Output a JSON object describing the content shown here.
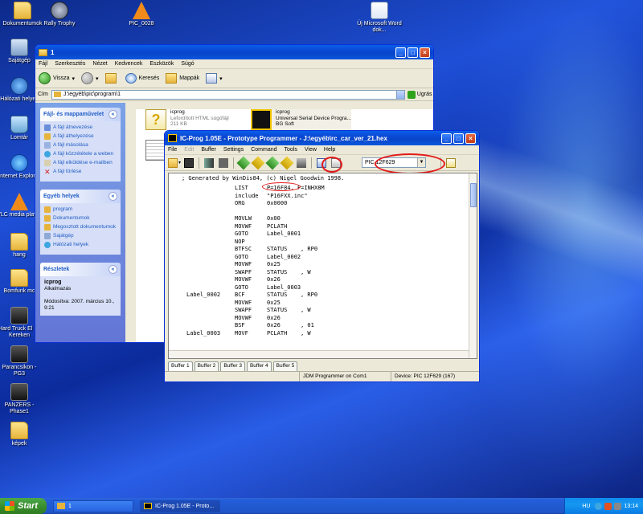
{
  "desktop": {
    "icons": [
      {
        "label": "Dokumentumok",
        "icon": "folder-icon"
      },
      {
        "label": "Rally Trophy",
        "icon": "game-icon"
      },
      {
        "label": "PIC_0028",
        "icon": "vlc-icon"
      },
      {
        "label": "Új Microsoft Word dok...",
        "icon": "word-icon"
      },
      {
        "label": "Sajátgép",
        "icon": "computer-icon"
      },
      {
        "label": "Hálózati helyek",
        "icon": "network-icon"
      },
      {
        "label": "Lomtár",
        "icon": "recycle-bin-icon"
      },
      {
        "label": "Internet Explorer",
        "icon": "internet-explorer-icon"
      },
      {
        "label": "VLC media player",
        "icon": "vlc-icon"
      },
      {
        "label": "hang",
        "icon": "folder-icon"
      },
      {
        "label": "Bomfunk mc",
        "icon": "folder-icon"
      },
      {
        "label": "Hard Truck El 18 Kereken",
        "icon": "game-icon"
      },
      {
        "label": "Parancsikon - PG3",
        "icon": "game-icon"
      },
      {
        "label": "PANZERS - Phase1",
        "icon": "game-icon"
      },
      {
        "label": "képek",
        "icon": "folder-icon"
      }
    ]
  },
  "explorer": {
    "title": "1",
    "menu": [
      "Fájl",
      "Szerkesztés",
      "Nézet",
      "Kedvencek",
      "Eszközök",
      "Súgó"
    ],
    "toolbar": {
      "back": "Vissza",
      "search": "Keresés",
      "folders": "Mappák"
    },
    "address": {
      "label": "Cím",
      "value": "J:\\egyéb\\pic\\program\\1",
      "go": "Ugrás"
    },
    "tasks_panel": {
      "title": "Fájl- és mappaművelet",
      "items": [
        "A fájl átnevezése",
        "A fájl áthelyezése",
        "A fájl másolása",
        "A fájl közzététele a weben",
        "A fájl elküldése e-mailben",
        "A fájl törlése"
      ]
    },
    "places_panel": {
      "title": "Egyéb helyek",
      "items": [
        "program",
        "Dokumentumok",
        "Megosztott dokumentumok",
        "Sajátgép",
        "Hálózati helyek"
      ]
    },
    "details_panel": {
      "title": "Részletek",
      "name": "icprog",
      "type": "Alkalmazás",
      "modified": "Módosítva: 2007. március 10., 9:21"
    },
    "files": [
      {
        "name": "icprog",
        "desc": "Lefordított HTML súgófájl",
        "size": "211 KB"
      },
      {
        "name": "icprog",
        "desc": "Universal Serial Device Progra...",
        "size": "BG Soft"
      }
    ]
  },
  "icprog": {
    "title": "IC-Prog 1.05E - Prototype Programmer - J:\\egyéb\\rc_car_ver_21.hex",
    "menu": [
      "File",
      "Edit",
      "Buffer",
      "Settings",
      "Command",
      "Tools",
      "View",
      "Help"
    ],
    "device_select": "PIC 12F629",
    "code_header": "; Generated by WinDis84, (c) Nigel Goodwin 1998.",
    "code_lines": [
      {
        "label": "",
        "op": "LIST",
        "arg": "P=16F84, F=INHX8M",
        "arg2": ""
      },
      {
        "label": "",
        "op": "include",
        "arg": "\"P16FXX.inc\"",
        "arg2": ""
      },
      {
        "label": "",
        "op": "ORG",
        "arg": "0x0000",
        "arg2": ""
      },
      {
        "label": "",
        "op": "",
        "arg": "",
        "arg2": ""
      },
      {
        "label": "",
        "op": "MOVLW",
        "arg": "0x00",
        "arg2": ""
      },
      {
        "label": "",
        "op": "MOVWF",
        "arg": "PCLATH",
        "arg2": ""
      },
      {
        "label": "",
        "op": "GOTO",
        "arg": "Label_0001",
        "arg2": ""
      },
      {
        "label": "",
        "op": "NOP",
        "arg": "",
        "arg2": ""
      },
      {
        "label": "",
        "op": "BTFSC",
        "arg": "STATUS",
        "arg2": ", RP0"
      },
      {
        "label": "",
        "op": "GOTO",
        "arg": "Label_0002",
        "arg2": ""
      },
      {
        "label": "",
        "op": "MOVWF",
        "arg": "0x25",
        "arg2": ""
      },
      {
        "label": "",
        "op": "SWAPF",
        "arg": "STATUS",
        "arg2": ", W"
      },
      {
        "label": "",
        "op": "MOVWF",
        "arg": "0x26",
        "arg2": ""
      },
      {
        "label": "",
        "op": "GOTO",
        "arg": "Label_0003",
        "arg2": ""
      },
      {
        "label": "Label_0002",
        "op": "BCF",
        "arg": "STATUS",
        "arg2": ", RP0"
      },
      {
        "label": "",
        "op": "MOVWF",
        "arg": "0x25",
        "arg2": ""
      },
      {
        "label": "",
        "op": "SWAPF",
        "arg": "STATUS",
        "arg2": ", W"
      },
      {
        "label": "",
        "op": "MOVWF",
        "arg": "0x26",
        "arg2": ""
      },
      {
        "label": "",
        "op": "BSF",
        "arg": "0x26",
        "arg2": ", 01"
      },
      {
        "label": "Label_0003",
        "op": "MOVF",
        "arg": "PCLATH",
        "arg2": ", W"
      }
    ],
    "buffers": [
      "Buffer 1",
      "Buffer 2",
      "Buffer 3",
      "Buffer 4",
      "Buffer 5"
    ],
    "status": {
      "programmer": "JDM Programmer on Com1",
      "device": "Device: PIC 12F629   (167)"
    }
  },
  "taskbar": {
    "start": "Start",
    "buttons": [
      "1",
      "IC-Prog 1.05E - Proto..."
    ],
    "lang": "HU",
    "clock": "13:14"
  }
}
